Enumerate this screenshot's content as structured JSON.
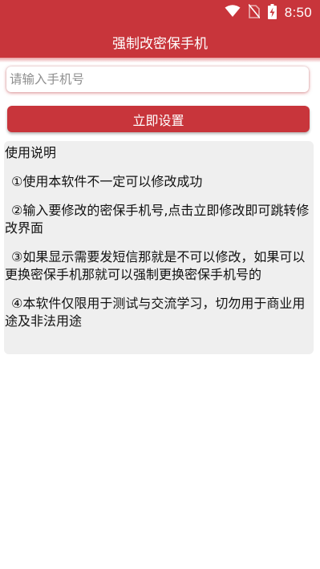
{
  "status_bar": {
    "time": "8:50",
    "icons": [
      "wifi-icon",
      "no-sim-icon",
      "battery-charging-icon"
    ]
  },
  "app_bar": {
    "title": "强制改密保手机"
  },
  "phone_input": {
    "placeholder": "请输入手机号",
    "value": ""
  },
  "set_button": {
    "label": "立即设置"
  },
  "instructions": {
    "heading": "使用说明",
    "items": [
      "①使用本软件不一定可以修改成功",
      "②输入要修改的密保手机号,点击立即修改即可跳转修改界面",
      "③如果显示需要发短信那就是不可以修改，如果可以更换密保手机那就可以强制更换密保手机号的",
      "④本软件仅限用于测试与交流学习，切勿用于商业用途及非法用途"
    ]
  },
  "colors": {
    "primary": "#c8353b",
    "panel_bg": "#efefef"
  }
}
